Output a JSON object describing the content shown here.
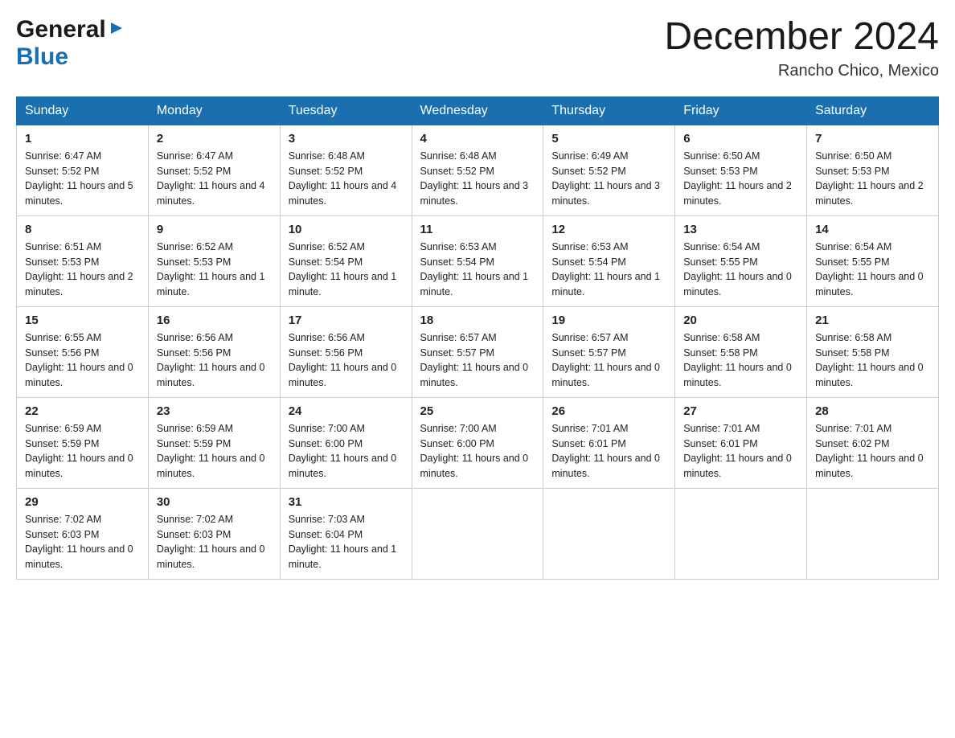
{
  "header": {
    "title": "December 2024",
    "location": "Rancho Chico, Mexico"
  },
  "logo": {
    "general": "General",
    "blue": "Blue"
  },
  "days": [
    "Sunday",
    "Monday",
    "Tuesday",
    "Wednesday",
    "Thursday",
    "Friday",
    "Saturday"
  ],
  "weeks": [
    [
      {
        "num": "1",
        "sunrise": "6:47 AM",
        "sunset": "5:52 PM",
        "daylight": "11 hours and 5 minutes."
      },
      {
        "num": "2",
        "sunrise": "6:47 AM",
        "sunset": "5:52 PM",
        "daylight": "11 hours and 4 minutes."
      },
      {
        "num": "3",
        "sunrise": "6:48 AM",
        "sunset": "5:52 PM",
        "daylight": "11 hours and 4 minutes."
      },
      {
        "num": "4",
        "sunrise": "6:48 AM",
        "sunset": "5:52 PM",
        "daylight": "11 hours and 3 minutes."
      },
      {
        "num": "5",
        "sunrise": "6:49 AM",
        "sunset": "5:52 PM",
        "daylight": "11 hours and 3 minutes."
      },
      {
        "num": "6",
        "sunrise": "6:50 AM",
        "sunset": "5:53 PM",
        "daylight": "11 hours and 2 minutes."
      },
      {
        "num": "7",
        "sunrise": "6:50 AM",
        "sunset": "5:53 PM",
        "daylight": "11 hours and 2 minutes."
      }
    ],
    [
      {
        "num": "8",
        "sunrise": "6:51 AM",
        "sunset": "5:53 PM",
        "daylight": "11 hours and 2 minutes."
      },
      {
        "num": "9",
        "sunrise": "6:52 AM",
        "sunset": "5:53 PM",
        "daylight": "11 hours and 1 minute."
      },
      {
        "num": "10",
        "sunrise": "6:52 AM",
        "sunset": "5:54 PM",
        "daylight": "11 hours and 1 minute."
      },
      {
        "num": "11",
        "sunrise": "6:53 AM",
        "sunset": "5:54 PM",
        "daylight": "11 hours and 1 minute."
      },
      {
        "num": "12",
        "sunrise": "6:53 AM",
        "sunset": "5:54 PM",
        "daylight": "11 hours and 1 minute."
      },
      {
        "num": "13",
        "sunrise": "6:54 AM",
        "sunset": "5:55 PM",
        "daylight": "11 hours and 0 minutes."
      },
      {
        "num": "14",
        "sunrise": "6:54 AM",
        "sunset": "5:55 PM",
        "daylight": "11 hours and 0 minutes."
      }
    ],
    [
      {
        "num": "15",
        "sunrise": "6:55 AM",
        "sunset": "5:56 PM",
        "daylight": "11 hours and 0 minutes."
      },
      {
        "num": "16",
        "sunrise": "6:56 AM",
        "sunset": "5:56 PM",
        "daylight": "11 hours and 0 minutes."
      },
      {
        "num": "17",
        "sunrise": "6:56 AM",
        "sunset": "5:56 PM",
        "daylight": "11 hours and 0 minutes."
      },
      {
        "num": "18",
        "sunrise": "6:57 AM",
        "sunset": "5:57 PM",
        "daylight": "11 hours and 0 minutes."
      },
      {
        "num": "19",
        "sunrise": "6:57 AM",
        "sunset": "5:57 PM",
        "daylight": "11 hours and 0 minutes."
      },
      {
        "num": "20",
        "sunrise": "6:58 AM",
        "sunset": "5:58 PM",
        "daylight": "11 hours and 0 minutes."
      },
      {
        "num": "21",
        "sunrise": "6:58 AM",
        "sunset": "5:58 PM",
        "daylight": "11 hours and 0 minutes."
      }
    ],
    [
      {
        "num": "22",
        "sunrise": "6:59 AM",
        "sunset": "5:59 PM",
        "daylight": "11 hours and 0 minutes."
      },
      {
        "num": "23",
        "sunrise": "6:59 AM",
        "sunset": "5:59 PM",
        "daylight": "11 hours and 0 minutes."
      },
      {
        "num": "24",
        "sunrise": "7:00 AM",
        "sunset": "6:00 PM",
        "daylight": "11 hours and 0 minutes."
      },
      {
        "num": "25",
        "sunrise": "7:00 AM",
        "sunset": "6:00 PM",
        "daylight": "11 hours and 0 minutes."
      },
      {
        "num": "26",
        "sunrise": "7:01 AM",
        "sunset": "6:01 PM",
        "daylight": "11 hours and 0 minutes."
      },
      {
        "num": "27",
        "sunrise": "7:01 AM",
        "sunset": "6:01 PM",
        "daylight": "11 hours and 0 minutes."
      },
      {
        "num": "28",
        "sunrise": "7:01 AM",
        "sunset": "6:02 PM",
        "daylight": "11 hours and 0 minutes."
      }
    ],
    [
      {
        "num": "29",
        "sunrise": "7:02 AM",
        "sunset": "6:03 PM",
        "daylight": "11 hours and 0 minutes."
      },
      {
        "num": "30",
        "sunrise": "7:02 AM",
        "sunset": "6:03 PM",
        "daylight": "11 hours and 0 minutes."
      },
      {
        "num": "31",
        "sunrise": "7:03 AM",
        "sunset": "6:04 PM",
        "daylight": "11 hours and 1 minute."
      },
      null,
      null,
      null,
      null
    ]
  ]
}
